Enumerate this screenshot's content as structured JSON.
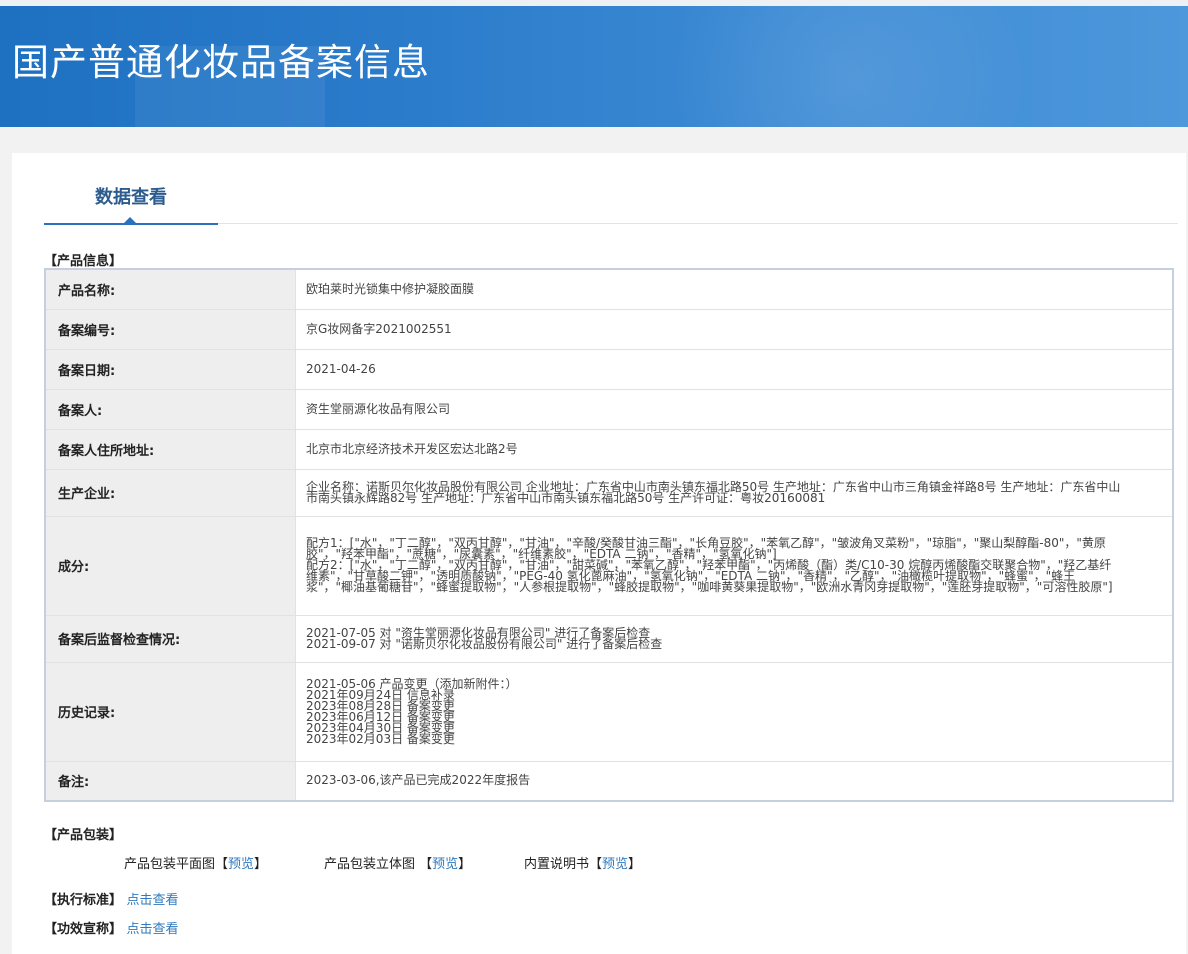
{
  "header": {
    "title": "国产普通化妆品备案信息"
  },
  "tab": {
    "label": "数据查看"
  },
  "product_info": {
    "section_title": "【产品信息】",
    "rows": [
      {
        "label": "产品名称:",
        "value": "欧珀莱时光锁集中修护凝胶面膜"
      },
      {
        "label": "备案编号:",
        "value": "京G妆网备字2021002551"
      },
      {
        "label": "备案日期:",
        "value": "2021-04-26"
      },
      {
        "label": "备案人:",
        "value": "资生堂丽源化妆品有限公司"
      },
      {
        "label": "备案人住所地址:",
        "value": "北京市北京经济技术开发区宏达北路2号"
      },
      {
        "label": "生产企业:",
        "value": "企业名称：诺斯贝尔化妆品股份有限公司 企业地址：广东省中山市南头镇东福北路50号 生产地址：广东省中山市三角镇金祥路8号 生产地址：广东省中山市南头镇永辉路82号 生产地址：广东省中山市南头镇东福北路50号 生产许可证：粤妆20160081"
      },
      {
        "label": "成分:",
        "lines": [
          "配方1：[\"水\"，\"丁二醇\"，\"双丙甘醇\"，\"甘油\"，\"辛酸/癸酸甘油三酯\"，\"长角豆胶\"，\"苯氧乙醇\"，\"皱波角叉菜粉\"，\"琼脂\"，\"聚山梨醇酯-80\"，\"黄原胶\"，\"羟苯甲酯\"，\"蔗糖\"，\"尿囊素\"，\"纤维素胶\"，\"EDTA 二钠\"，\"香精\"，\"氢氧化钠\"]",
          "配方2：[\"水\"，\"丁二醇\"，\"双丙甘醇\"，\"甘油\"，\"甜菜碱\"，\"苯氧乙醇\"，\"羟苯甲酯\"，\"丙烯酸（酯）类/C10-30 烷醇丙烯酸酯交联聚合物\"，\"羟乙基纤维素\"，\"甘草酸二钾\"，\"透明质酸钠\"，\"PEG-40 氢化蓖麻油\"，\"氢氧化钠\"，\"EDTA 二钠\"，\"香精\"，\"乙醇\"，\"油橄榄叶提取物\"，\"蜂蜜\"，\"蜂王浆\"，\"椰油基葡糖苷\"，\"蜂蜜提取物\"，\"人参根提取物\"，\"蜂胶提取物\"，\"咖啡黄葵果提取物\"，\"欧洲水青冈芽提取物\"，\"莲胚芽提取物\"，\"可溶性胶原\"]"
        ]
      },
      {
        "label": "备案后监督检查情况:",
        "lines": [
          "2021-07-05 对 \"资生堂丽源化妆品有限公司\" 进行了备案后检查",
          "2021-09-07 对 \"诺斯贝尔化妆品股份有限公司\" 进行了备案后检查"
        ]
      },
      {
        "label": "历史记录:",
        "lines": [
          "2021-05-06 产品变更（添加新附件：）",
          "2021年09月24日 信息补录",
          "2023年08月28日 备案变更",
          "2023年06月12日 备案变更",
          "2023年04月30日 备案变更",
          "2023年02月03日 备案变更"
        ]
      },
      {
        "label": "备注:",
        "value": "2023-03-06,该产品已完成2022年度报告"
      }
    ]
  },
  "packaging": {
    "section_title": "【产品包装】",
    "items": [
      {
        "name": "产品包装平面图",
        "link_label": "预览"
      },
      {
        "name": "产品包装立体图",
        "link_label": "预览"
      },
      {
        "name": "内置说明书",
        "link_label": "预览"
      }
    ]
  },
  "standard": {
    "title": "【执行标准】",
    "link_label": "点击查看"
  },
  "efficacy": {
    "title": "【功效宣称】",
    "link_label": "点击查看"
  }
}
